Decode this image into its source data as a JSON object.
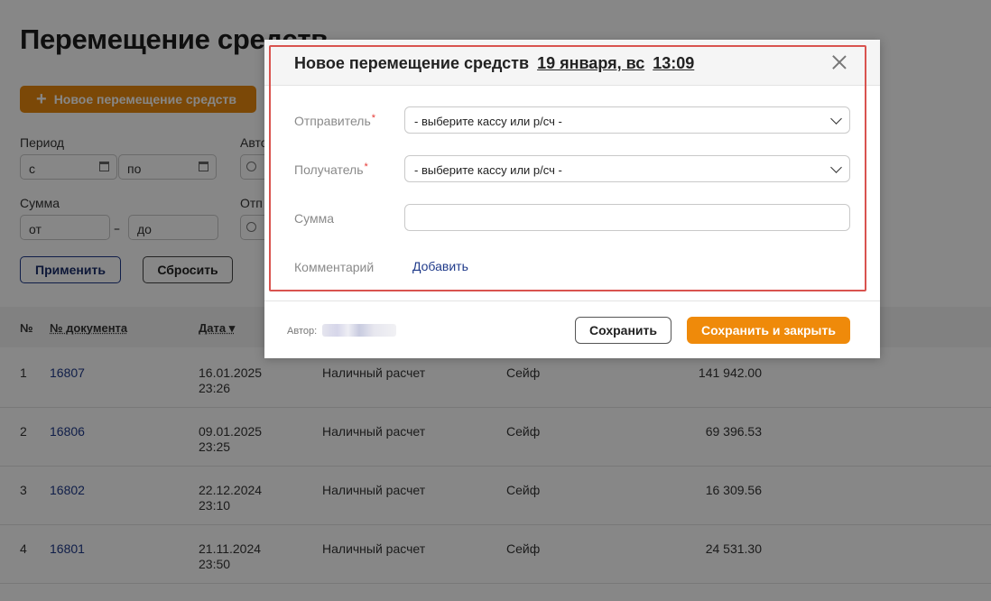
{
  "page": {
    "title": "Перемещение средств",
    "new_button": "Новое перемещение средств",
    "filters": {
      "period_label": "Период",
      "period_from": "с",
      "period_to": "по",
      "author_label": "Авто",
      "sum_label": "Сумма",
      "sum_from": "от",
      "sum_dash": "–",
      "sum_to": "до",
      "sender_label": "Отп",
      "apply": "Применить",
      "reset": "Сбросить"
    },
    "table": {
      "headers": {
        "num": "№",
        "doc": "№ документа",
        "date": "Дата ▾"
      },
      "rows": [
        {
          "num": "1",
          "doc": "16807",
          "date": "16.01.2025",
          "time": "23:26",
          "type": "Наличный расчет",
          "target": "Сейф",
          "amount": "141 942.00"
        },
        {
          "num": "2",
          "doc": "16806",
          "date": "09.01.2025",
          "time": "23:25",
          "type": "Наличный расчет",
          "target": "Сейф",
          "amount": "69 396.53"
        },
        {
          "num": "3",
          "doc": "16802",
          "date": "22.12.2024",
          "time": "23:10",
          "type": "Наличный расчет",
          "target": "Сейф",
          "amount": "16 309.56"
        },
        {
          "num": "4",
          "doc": "16801",
          "date": "21.11.2024",
          "time": "23:50",
          "type": "Наличный расчет",
          "target": "Сейф",
          "amount": "24 531.30"
        }
      ]
    }
  },
  "modal": {
    "title": "Новое перемещение средств",
    "date": "19 января, вс",
    "time": "13:09",
    "sender_label": "Отправитель",
    "sender_value": "- выберите кассу или р/сч -",
    "receiver_label": "Получатель",
    "receiver_value": "- выберите кассу или р/сч -",
    "required_mark": "*",
    "sum_label": "Сумма",
    "sum_value": "",
    "comment_label": "Комментарий",
    "comment_add": "Добавить",
    "author_label": "Автор:",
    "save": "Сохранить",
    "save_close": "Сохранить и закрыть"
  },
  "colors": {
    "accent": "#ef8a0a",
    "link": "#1f3a8a",
    "highlight": "#d9534f",
    "required": "#e53935"
  }
}
